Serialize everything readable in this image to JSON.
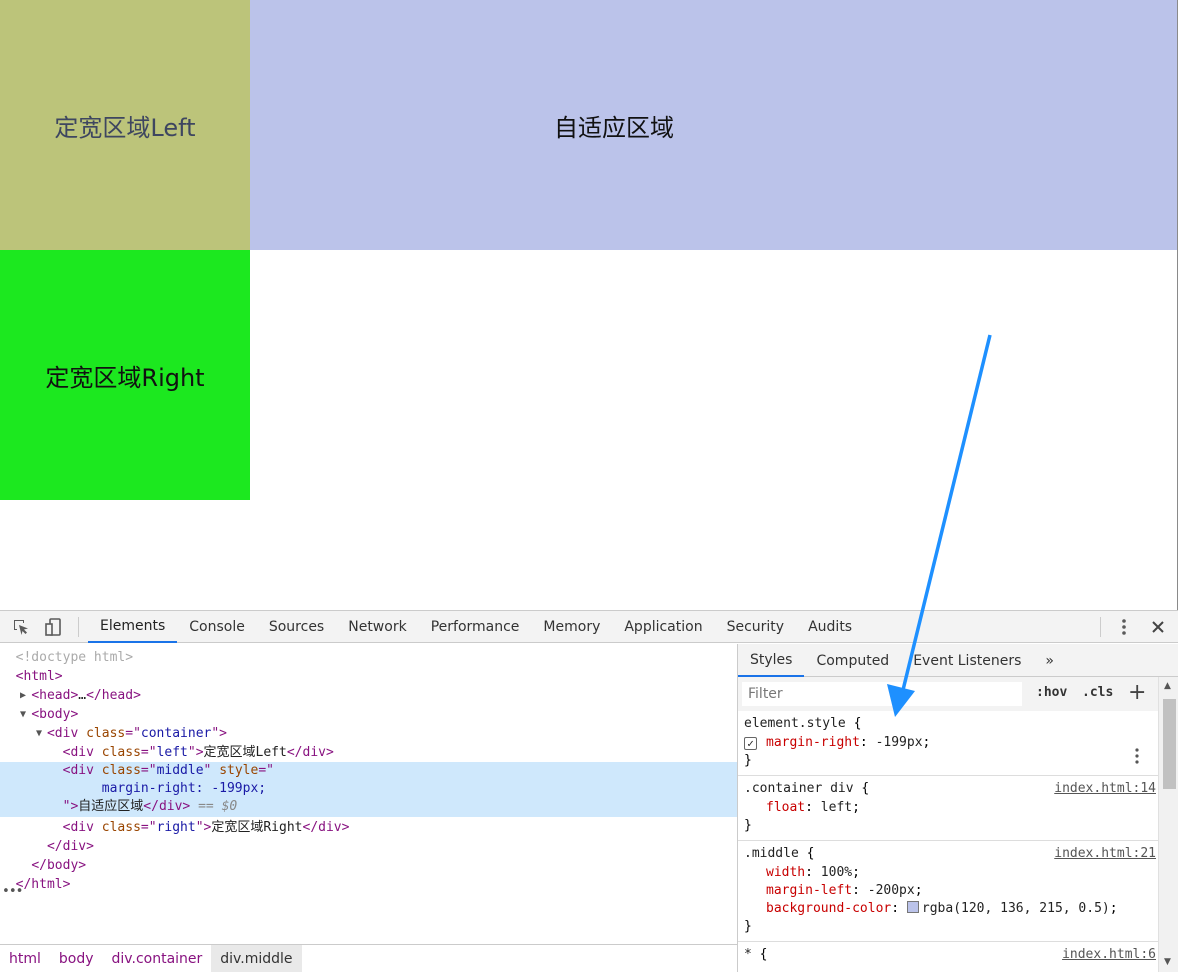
{
  "page": {
    "left_label": "定宽区域Left",
    "middle_label": "自适应区域",
    "right_label": "定宽区域Right",
    "colors": {
      "left": "#bcc47a",
      "middle": "#bbc3ea",
      "right": "#1ce81f"
    }
  },
  "devtools": {
    "toolbar": {
      "tabs": [
        "Elements",
        "Console",
        "Sources",
        "Network",
        "Performance",
        "Memory",
        "Application",
        "Security",
        "Audits"
      ],
      "active_tab": "Elements",
      "icons": [
        "inspect-icon",
        "device-toggle-icon",
        "more-vert-icon",
        "close-icon"
      ]
    },
    "elements": {
      "doctype": "<!doctype html>",
      "html_open": "<html>",
      "head_open": "<head>",
      "head_ellipsis": "…",
      "head_close": "</head>",
      "body_open": "<body>",
      "div": "div",
      "class_attr": "class",
      "style_attr": "style",
      "container_class": "container",
      "left_class": "left",
      "middle_class": "middle",
      "right_class": "right",
      "left_text": "定宽区域Left",
      "middle_style_value": "margin-right: -199px;",
      "middle_text": "自适应区域",
      "right_text": "定宽区域Right",
      "div_close": "</div>",
      "body_close": "</body>",
      "html_close": "</html>",
      "selected_marker": "== $0"
    },
    "breadcrumbs": [
      "html",
      "body",
      "div.container",
      "div.middle"
    ],
    "styles": {
      "tabs": [
        "Styles",
        "Computed",
        "Event Listeners"
      ],
      "more_tabs": "»",
      "filter_placeholder": "Filter",
      "hov": ":hov",
      "cls": ".cls",
      "add": "+",
      "rules": [
        {
          "selector": "element.style",
          "source": "",
          "properties": [
            {
              "name": "margin-right",
              "value": "-199px",
              "checked": true
            }
          ]
        },
        {
          "selector": ".container div",
          "source": "index.html:14",
          "properties": [
            {
              "name": "float",
              "value": "left"
            }
          ]
        },
        {
          "selector": ".middle",
          "source": "index.html:21",
          "properties": [
            {
              "name": "width",
              "value": "100%"
            },
            {
              "name": "margin-left",
              "value": "-200px"
            },
            {
              "name": "background-color",
              "value": "rgba(120, 136, 215, 0.5)",
              "swatch": "#bbc3ea"
            }
          ]
        },
        {
          "selector": "*",
          "source": "index.html:6",
          "properties": []
        }
      ]
    }
  },
  "annotation": {
    "arrow_color": "#1e90ff"
  }
}
